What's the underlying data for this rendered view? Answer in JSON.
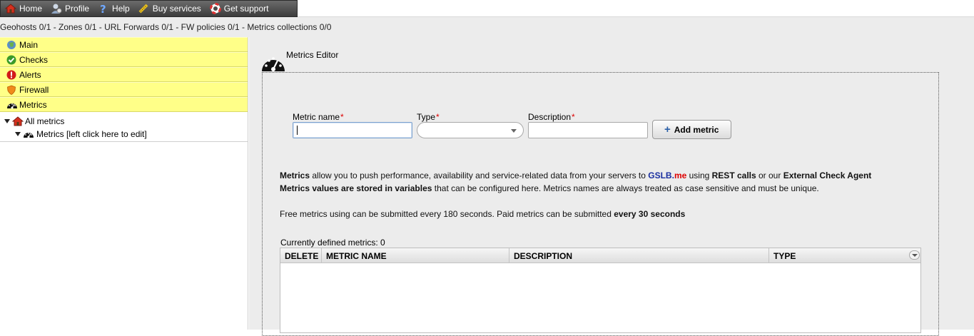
{
  "nav": {
    "items": [
      {
        "label": "Home",
        "icon": "home-icon"
      },
      {
        "label": "Profile",
        "icon": "profile-icon"
      },
      {
        "label": "Help",
        "icon": "help-icon"
      },
      {
        "label": "Buy services",
        "icon": "buy-icon"
      },
      {
        "label": "Get support",
        "icon": "support-icon"
      }
    ]
  },
  "status": {
    "text": "Geohosts 0/1 - Zones 0/1 - URL Forwards 0/1 - FW policies 0/1 - Metrics collections 0/0"
  },
  "sidebar": {
    "accordion": [
      {
        "label": "Main",
        "icon": "globe-icon"
      },
      {
        "label": "Checks",
        "icon": "check-icon"
      },
      {
        "label": "Alerts",
        "icon": "alert-icon"
      },
      {
        "label": "Firewall",
        "icon": "shield-icon"
      },
      {
        "label": "Metrics",
        "icon": "gauge-icon"
      }
    ],
    "tree": {
      "root": "All metrics",
      "child": "Metrics [left click here to edit]"
    }
  },
  "editor": {
    "title": "Metrics Editor",
    "form": {
      "name_label": "Metric name",
      "type_label": "Type",
      "description_label": "Description",
      "required_mark": "*",
      "name_value": "",
      "type_value": "",
      "description_value": "",
      "add_button": "Add metric"
    },
    "info": {
      "line1_a": "Metrics",
      "line1_b": " allow you to push performance, availability and service-related data from your servers to ",
      "brand_a": "GSLB.",
      "brand_b": "me",
      "line1_c": " using ",
      "line1_d": "REST calls",
      "line1_e": " or our ",
      "line1_f": "External Check Agent",
      "line2_a": "Metrics values are stored in variables",
      "line2_b": " that can be configured here. Metrics names are always treated as case sensitive and must be unique.",
      "line3_a": "Free metrics using can be submitted every 180 seconds. Paid metrics can be submitted ",
      "line3_b": "every 30 seconds"
    },
    "table": {
      "count_label": "Currently defined metrics: 0",
      "columns": [
        "DELETE",
        "METRIC NAME",
        "DESCRIPTION",
        "TYPE"
      ],
      "rows": []
    }
  },
  "colors": {
    "accordion_bg": "#ffff88",
    "nav_bg": "#4a4a4a",
    "brand_blue": "#1a2fa0",
    "brand_red": "#dd0000"
  }
}
